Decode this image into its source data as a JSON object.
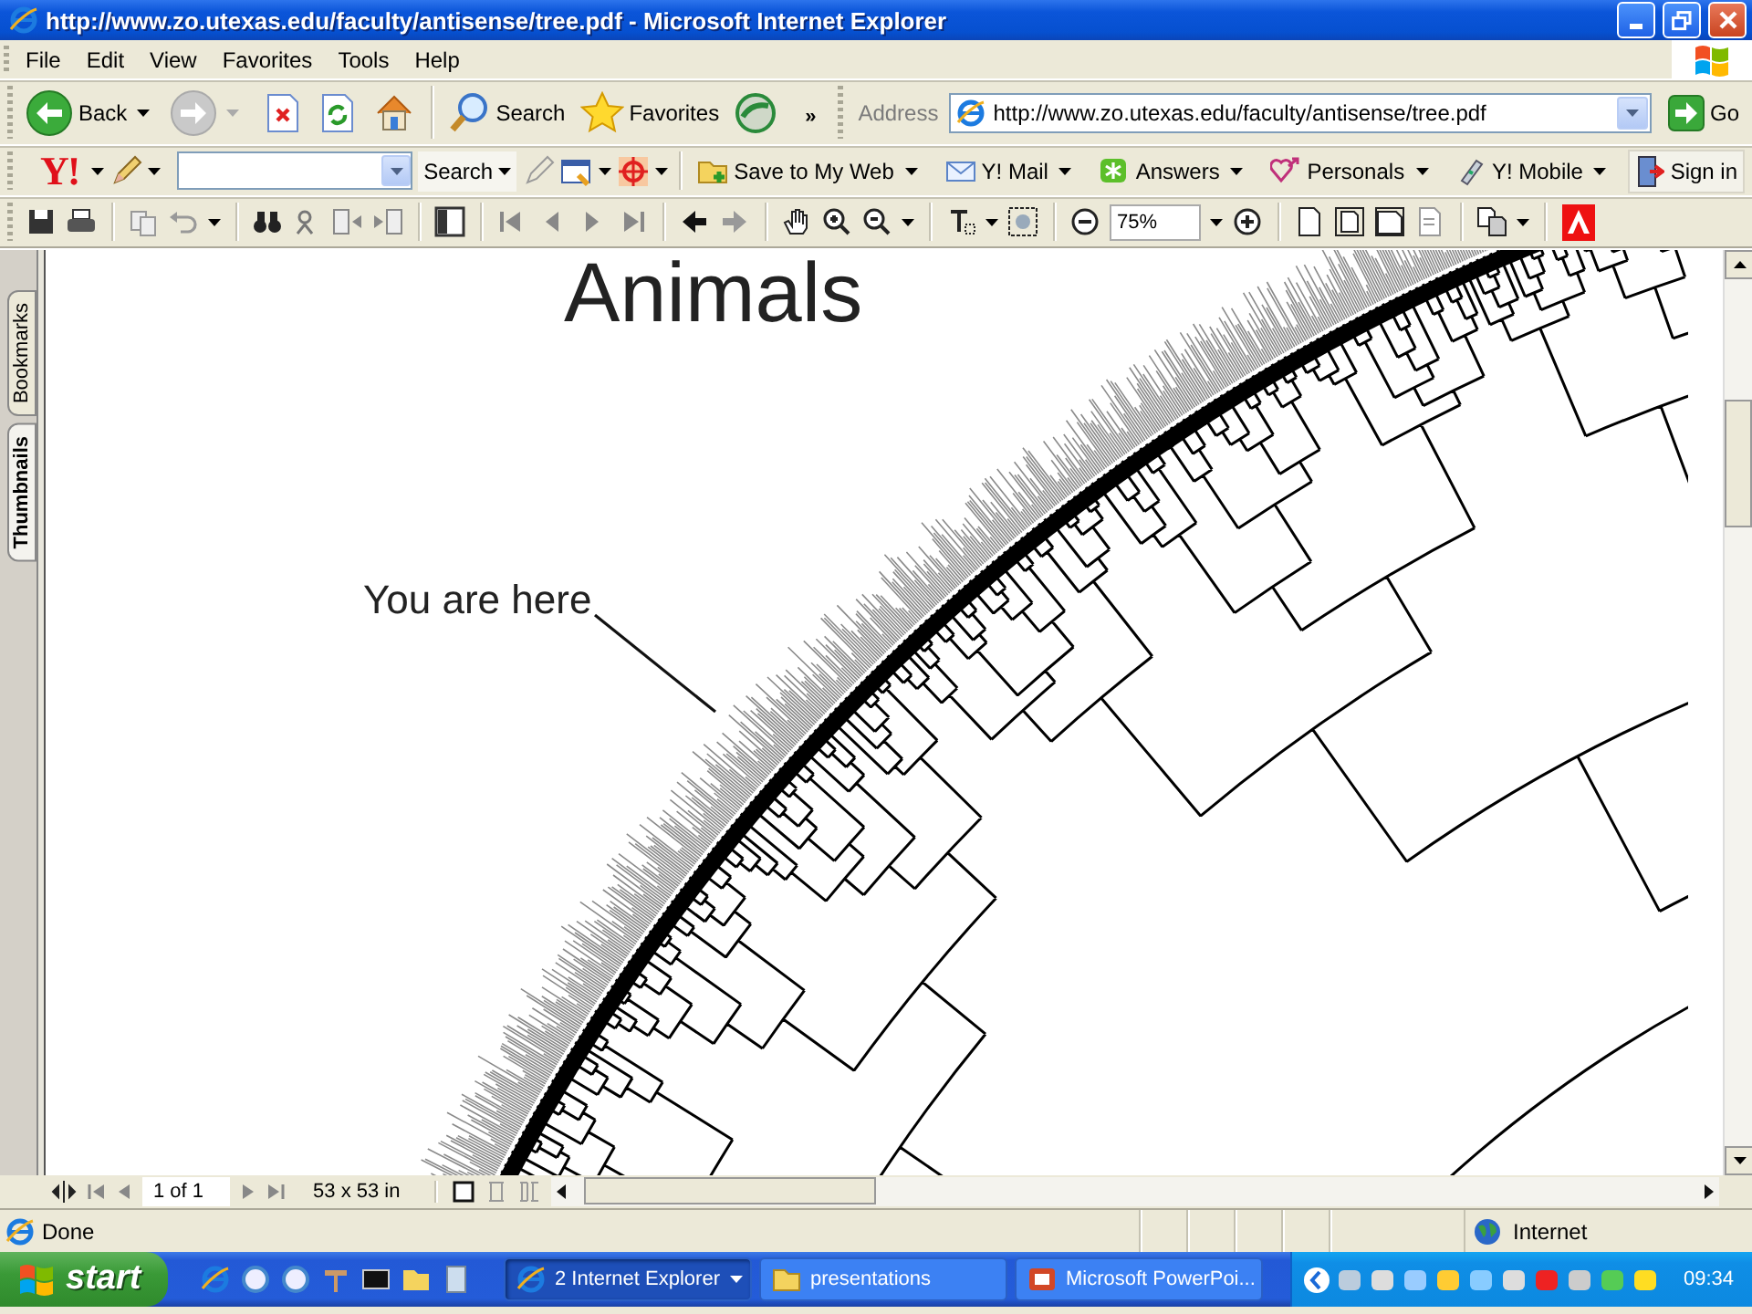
{
  "window": {
    "title": "http://www.zo.utexas.edu/faculty/antisense/tree.pdf - Microsoft Internet Explorer"
  },
  "menu": [
    "File",
    "Edit",
    "View",
    "Favorites",
    "Tools",
    "Help"
  ],
  "toolbar": {
    "back": "Back",
    "search": "Search",
    "favorites": "Favorites",
    "chevron": "»",
    "address_label": "Address",
    "address": "http://www.zo.utexas.edu/faculty/antisense/tree.pdf",
    "go": "Go"
  },
  "yahoo_toolbar": {
    "logo": "Y!",
    "search_button": "Search",
    "items": [
      {
        "label": "Save to My Web"
      },
      {
        "label": "Y! Mail"
      },
      {
        "label": "Answers"
      },
      {
        "label": "Personals"
      },
      {
        "label": "Y! Mobile"
      }
    ],
    "sign_in": "Sign in"
  },
  "pdf_toolbar": {
    "zoom": "75%"
  },
  "side_tabs": [
    {
      "label": "Bookmarks",
      "selected": false
    },
    {
      "label": "Thumbnails",
      "selected": true
    }
  ],
  "document": {
    "heading": "Animals",
    "callout": "You are here"
  },
  "pdf_nav": {
    "page": "1 of 1",
    "page_size": "53 x 53 in"
  },
  "status_bar": {
    "text": "Done",
    "zone": "Internet"
  },
  "taskbar": {
    "start": "start",
    "tasks": [
      {
        "label": "2 Internet Explorer",
        "selected": true
      },
      {
        "label": "presentations",
        "selected": false
      },
      {
        "label": "Microsoft PowerPoi...",
        "selected": false
      }
    ],
    "clock": "09:34"
  }
}
